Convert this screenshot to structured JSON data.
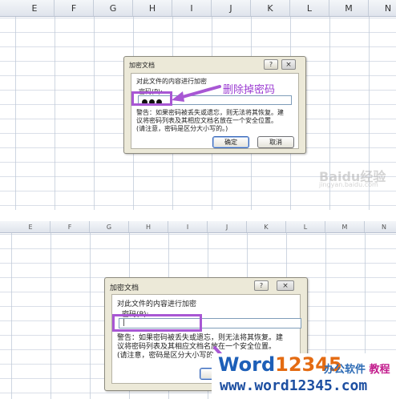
{
  "top": {
    "columns": [
      "E",
      "F",
      "G",
      "H",
      "I",
      "J",
      "K",
      "L",
      "M",
      "N"
    ],
    "dialog": {
      "title": "加密文档",
      "help": "?",
      "close": "×",
      "group_label": "对此文件的内容进行加密",
      "password_label": "密码(P):",
      "password_mask_count": 3,
      "warning_lines": [
        "警告：如果密码被丢失或遗忘，则无法将其恢复。建",
        "议将密码列表及其相应文档名放在一个安全位置。",
        "(请注意，密码是区分大小写的。)"
      ],
      "ok": "确定",
      "cancel": "取消"
    },
    "callout": "删除掉密码",
    "watermark": "Baidu经验",
    "watermark_sub": "jingyan.baidu.com"
  },
  "bottom": {
    "columns": [
      "E",
      "F",
      "G",
      "H",
      "I",
      "J",
      "K",
      "L",
      "M",
      "N"
    ],
    "dialog": {
      "title": "加密文档",
      "help": "?",
      "close": "×",
      "group_label": "对此文件的内容进行加密",
      "password_label": "密码(P):",
      "password_value": "|",
      "warning_lines": [
        "警告：如果密码被丢失或遗忘，则无法将其恢复。建",
        "议将密码列表及其相应文档名放在一个安全位置。",
        "(请注意，密码是区分大小写的。)"
      ]
    }
  },
  "logo": {
    "word": "Word",
    "num": "12345",
    "cn_a": "办公软件",
    "cn_b": "教程",
    "url": "www.word12345.com"
  },
  "colors": {
    "highlight": "#a857d4",
    "callout": "#9b3bd2",
    "dialog_bg": "#ece9d8"
  }
}
